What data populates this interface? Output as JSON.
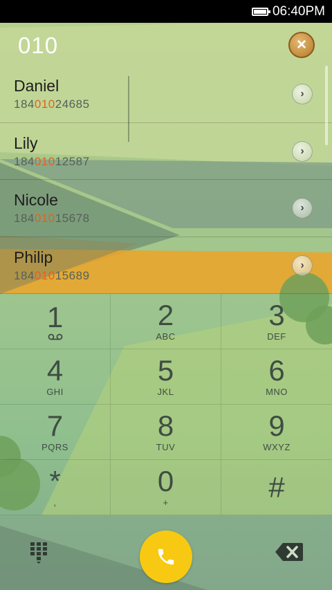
{
  "status_bar": {
    "time": "06:40PM"
  },
  "dialer": {
    "number": "010"
  },
  "contacts": [
    {
      "name": "Daniel",
      "number_prefix": "184",
      "number_match": "010",
      "number_suffix": "24685"
    },
    {
      "name": "Lily",
      "number_prefix": "184",
      "number_match": "010",
      "number_suffix": "12587"
    },
    {
      "name": "Nicole",
      "number_prefix": "184",
      "number_match": "010",
      "number_suffix": "15678"
    },
    {
      "name": "Philip",
      "number_prefix": "184",
      "number_match": "010",
      "number_suffix": "15689"
    }
  ],
  "keypad": [
    {
      "digit": "1",
      "letters": ""
    },
    {
      "digit": "2",
      "letters": "ABC"
    },
    {
      "digit": "3",
      "letters": "DEF"
    },
    {
      "digit": "4",
      "letters": "GHI"
    },
    {
      "digit": "5",
      "letters": "JKL"
    },
    {
      "digit": "6",
      "letters": "MNO"
    },
    {
      "digit": "7",
      "letters": "PQRS"
    },
    {
      "digit": "8",
      "letters": "TUV"
    },
    {
      "digit": "9",
      "letters": "WXYZ"
    },
    {
      "digit": "*",
      "letters": ","
    },
    {
      "digit": "0",
      "letters": "+"
    },
    {
      "digit": "#",
      "letters": ""
    }
  ],
  "icons": {
    "clear": "close-icon",
    "detail": "chevron-right-icon",
    "voicemail": "voicemail-icon",
    "keypad_toggle": "dialpad-icon",
    "call": "phone-icon",
    "backspace": "backspace-icon",
    "battery": "battery-icon"
  },
  "colors": {
    "match_highlight": "#e2611e",
    "call_button": "#f7c912",
    "clear_button": "#c8923c"
  }
}
